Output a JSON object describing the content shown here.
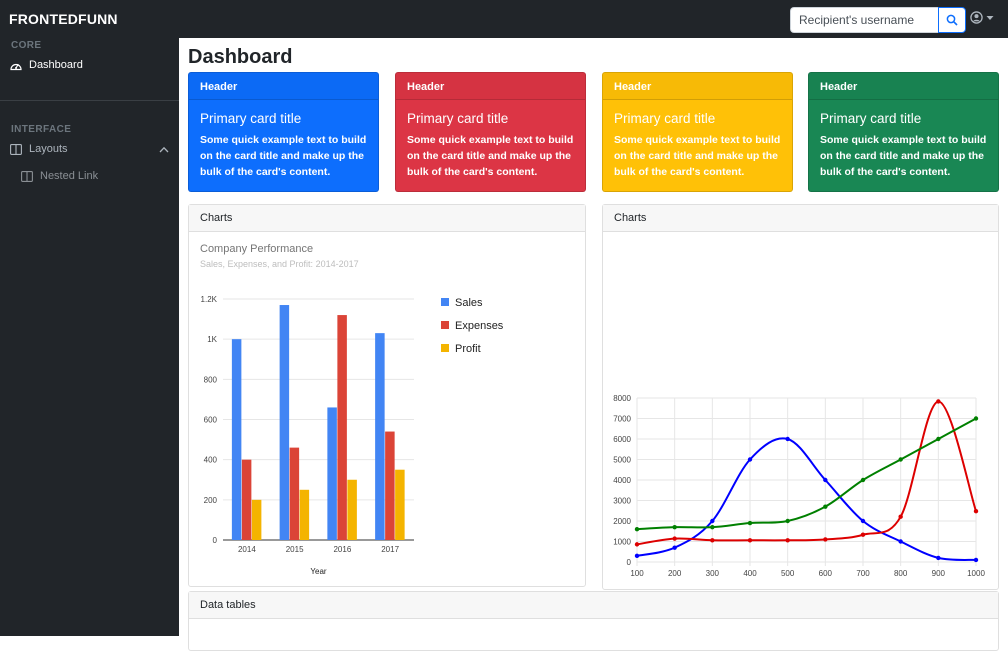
{
  "app": {
    "brand": "FRONTEDFUNN"
  },
  "search": {
    "placeholder": "Recipient's username"
  },
  "sidebar": {
    "core_heading": "CORE",
    "dashboard_label": "Dashboard",
    "interface_heading": "INTERFACE",
    "layouts_label": "Layouts",
    "nested_label": "Nested Link"
  },
  "page": {
    "title": "Dashboard"
  },
  "cards": [
    {
      "header": "Header",
      "title": "Primary card title",
      "text": "Some quick example text to build on the card title and make up the bulk of the card's content.",
      "color": "#0d6efd"
    },
    {
      "header": "Header",
      "title": "Primary card title",
      "text": "Some quick example text to build on the card title and make up the bulk of the card's content.",
      "color": "#dc3545"
    },
    {
      "header": "Header",
      "title": "Primary card title",
      "text": "Some quick example text to build on the card title and make up the bulk of the card's content.",
      "color": "#ffc107"
    },
    {
      "header": "Header",
      "title": "Primary card title",
      "text": "Some quick example text to build on the card title and make up the bulk of the card's content.",
      "color": "#198754"
    }
  ],
  "panels": {
    "charts_left": "Charts",
    "charts_right": "Charts",
    "data_tables": "Data tables"
  },
  "icons": {
    "brand_search": "search-icon",
    "user": "user-circle-icon",
    "dashboard": "tachometer-icon",
    "layouts": "columns-icon",
    "nested": "columns-icon"
  },
  "chart_data": [
    {
      "type": "bar",
      "title": "Company Performance",
      "subtitle": "Sales, Expenses, and Profit: 2014-2017",
      "xlabel": "Year",
      "ylabel": "",
      "categories": [
        "2014",
        "2015",
        "2016",
        "2017"
      ],
      "ylim": [
        0,
        1200
      ],
      "yticks": [
        0,
        200,
        400,
        600,
        800,
        1000,
        1200
      ],
      "ytick_labels": [
        "0",
        "200",
        "400",
        "600",
        "800",
        "1K",
        "1.2K"
      ],
      "legend": "right",
      "grid": true,
      "series": [
        {
          "name": "Sales",
          "color": "#4285f4",
          "values": [
            1000,
            1170,
            660,
            1030
          ]
        },
        {
          "name": "Expenses",
          "color": "#db4437",
          "values": [
            400,
            460,
            1120,
            540
          ]
        },
        {
          "name": "Profit",
          "color": "#f4b400",
          "values": [
            200,
            250,
            300,
            350
          ]
        }
      ]
    },
    {
      "type": "line",
      "title": "",
      "xlabel": "",
      "ylabel": "",
      "x": [
        100,
        200,
        300,
        400,
        500,
        600,
        700,
        800,
        900,
        1000
      ],
      "xlim": [
        100,
        1000
      ],
      "ylim": [
        0,
        8000
      ],
      "yticks": [
        0,
        1000,
        2000,
        3000,
        4000,
        5000,
        6000,
        7000,
        8000
      ],
      "grid": true,
      "series": [
        {
          "color": "#0000ff",
          "values": [
            300,
            700,
            2000,
            5000,
            6000,
            4000,
            2000,
            1000,
            200,
            100
          ]
        },
        {
          "color": "#dd0000",
          "values": [
            860,
            1140,
            1060,
            1060,
            1060,
            1100,
            1330,
            2210,
            7830,
            2480
          ]
        },
        {
          "color": "#008000",
          "values": [
            1600,
            1700,
            1700,
            1900,
            2000,
            2700,
            4000,
            5000,
            6000,
            7000
          ]
        }
      ]
    }
  ]
}
